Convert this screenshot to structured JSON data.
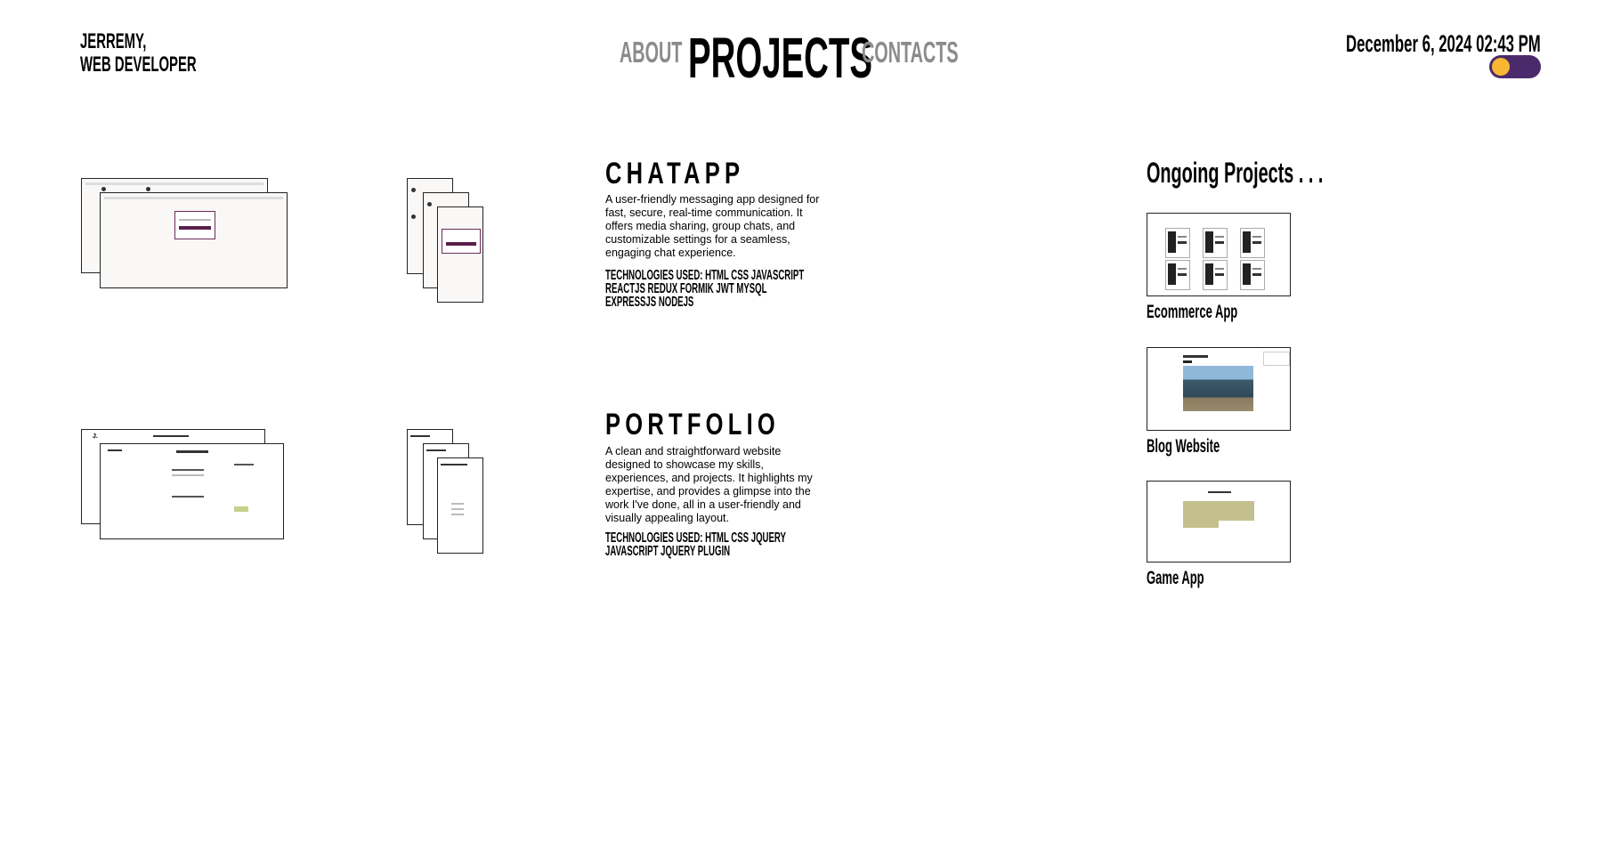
{
  "brand": {
    "line1": "JERREMY,",
    "line2": "WEB DEVELOPER"
  },
  "nav": {
    "about": "ABOUT",
    "projects": "PROJECTS",
    "contacts": "CONTACTS"
  },
  "datetime": "December 6, 2024 02:43 PM",
  "theme_toggle": {
    "state": "dark",
    "knob_color": "#f7b733",
    "track_color": "#4b2a6b"
  },
  "projects": [
    {
      "title": "CHATAPP",
      "description": "A user-friendly messaging app designed for fast, secure, real-time communication. It offers media sharing, group chats, and customizable settings for a seamless, engaging chat experience.",
      "technologies": "TECHNOLOGIES USED: HTML CSS JAVASCRIPT REACTJS REDUX FORMIK JWT MYSQL EXPRESSJS NODEJS"
    },
    {
      "title": "PORTFOLIO",
      "description": "A clean and straightforward website designed to showcase my skills, experiences, and projects. It highlights my expertise, and provides a glimpse into the work I've done, all in a user-friendly and visually appealing layout.",
      "technologies": "TECHNOLOGIES USED: HTML CSS JQUERY JAVASCRIPT JQUERY PLUGIN"
    }
  ],
  "ongoing": {
    "title": "Ongoing Projects . . .",
    "items": [
      {
        "label": "Ecommerce App"
      },
      {
        "label": "Blog Website"
      },
      {
        "label": "Game App"
      }
    ]
  }
}
